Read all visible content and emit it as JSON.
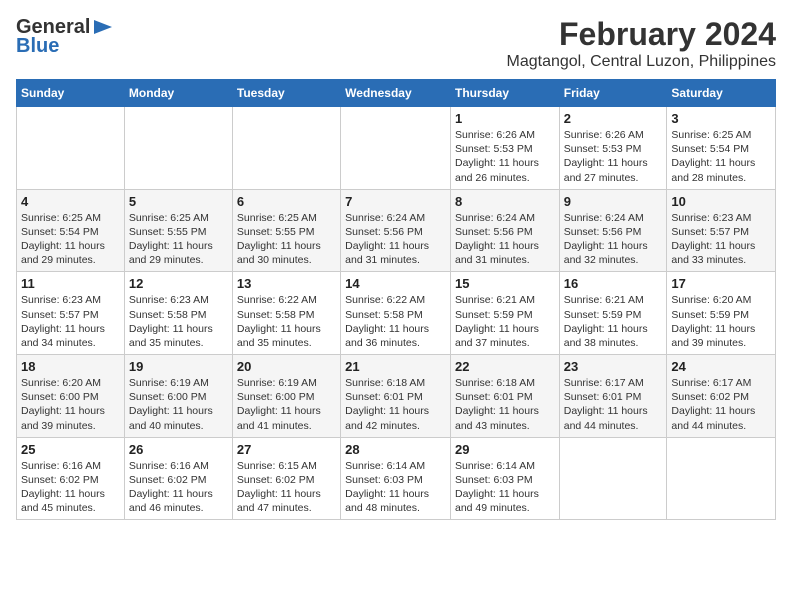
{
  "header": {
    "logo_general": "General",
    "logo_blue": "Blue",
    "month_year": "February 2024",
    "location": "Magtangol, Central Luzon, Philippines"
  },
  "weekdays": [
    "Sunday",
    "Monday",
    "Tuesday",
    "Wednesday",
    "Thursday",
    "Friday",
    "Saturday"
  ],
  "weeks": [
    [
      {
        "day": "",
        "info": ""
      },
      {
        "day": "",
        "info": ""
      },
      {
        "day": "",
        "info": ""
      },
      {
        "day": "",
        "info": ""
      },
      {
        "day": "1",
        "info": "Sunrise: 6:26 AM\nSunset: 5:53 PM\nDaylight: 11 hours and 26 minutes."
      },
      {
        "day": "2",
        "info": "Sunrise: 6:26 AM\nSunset: 5:53 PM\nDaylight: 11 hours and 27 minutes."
      },
      {
        "day": "3",
        "info": "Sunrise: 6:25 AM\nSunset: 5:54 PM\nDaylight: 11 hours and 28 minutes."
      }
    ],
    [
      {
        "day": "4",
        "info": "Sunrise: 6:25 AM\nSunset: 5:54 PM\nDaylight: 11 hours and 29 minutes."
      },
      {
        "day": "5",
        "info": "Sunrise: 6:25 AM\nSunset: 5:55 PM\nDaylight: 11 hours and 29 minutes."
      },
      {
        "day": "6",
        "info": "Sunrise: 6:25 AM\nSunset: 5:55 PM\nDaylight: 11 hours and 30 minutes."
      },
      {
        "day": "7",
        "info": "Sunrise: 6:24 AM\nSunset: 5:56 PM\nDaylight: 11 hours and 31 minutes."
      },
      {
        "day": "8",
        "info": "Sunrise: 6:24 AM\nSunset: 5:56 PM\nDaylight: 11 hours and 31 minutes."
      },
      {
        "day": "9",
        "info": "Sunrise: 6:24 AM\nSunset: 5:56 PM\nDaylight: 11 hours and 32 minutes."
      },
      {
        "day": "10",
        "info": "Sunrise: 6:23 AM\nSunset: 5:57 PM\nDaylight: 11 hours and 33 minutes."
      }
    ],
    [
      {
        "day": "11",
        "info": "Sunrise: 6:23 AM\nSunset: 5:57 PM\nDaylight: 11 hours and 34 minutes."
      },
      {
        "day": "12",
        "info": "Sunrise: 6:23 AM\nSunset: 5:58 PM\nDaylight: 11 hours and 35 minutes."
      },
      {
        "day": "13",
        "info": "Sunrise: 6:22 AM\nSunset: 5:58 PM\nDaylight: 11 hours and 35 minutes."
      },
      {
        "day": "14",
        "info": "Sunrise: 6:22 AM\nSunset: 5:58 PM\nDaylight: 11 hours and 36 minutes."
      },
      {
        "day": "15",
        "info": "Sunrise: 6:21 AM\nSunset: 5:59 PM\nDaylight: 11 hours and 37 minutes."
      },
      {
        "day": "16",
        "info": "Sunrise: 6:21 AM\nSunset: 5:59 PM\nDaylight: 11 hours and 38 minutes."
      },
      {
        "day": "17",
        "info": "Sunrise: 6:20 AM\nSunset: 5:59 PM\nDaylight: 11 hours and 39 minutes."
      }
    ],
    [
      {
        "day": "18",
        "info": "Sunrise: 6:20 AM\nSunset: 6:00 PM\nDaylight: 11 hours and 39 minutes."
      },
      {
        "day": "19",
        "info": "Sunrise: 6:19 AM\nSunset: 6:00 PM\nDaylight: 11 hours and 40 minutes."
      },
      {
        "day": "20",
        "info": "Sunrise: 6:19 AM\nSunset: 6:00 PM\nDaylight: 11 hours and 41 minutes."
      },
      {
        "day": "21",
        "info": "Sunrise: 6:18 AM\nSunset: 6:01 PM\nDaylight: 11 hours and 42 minutes."
      },
      {
        "day": "22",
        "info": "Sunrise: 6:18 AM\nSunset: 6:01 PM\nDaylight: 11 hours and 43 minutes."
      },
      {
        "day": "23",
        "info": "Sunrise: 6:17 AM\nSunset: 6:01 PM\nDaylight: 11 hours and 44 minutes."
      },
      {
        "day": "24",
        "info": "Sunrise: 6:17 AM\nSunset: 6:02 PM\nDaylight: 11 hours and 44 minutes."
      }
    ],
    [
      {
        "day": "25",
        "info": "Sunrise: 6:16 AM\nSunset: 6:02 PM\nDaylight: 11 hours and 45 minutes."
      },
      {
        "day": "26",
        "info": "Sunrise: 6:16 AM\nSunset: 6:02 PM\nDaylight: 11 hours and 46 minutes."
      },
      {
        "day": "27",
        "info": "Sunrise: 6:15 AM\nSunset: 6:02 PM\nDaylight: 11 hours and 47 minutes."
      },
      {
        "day": "28",
        "info": "Sunrise: 6:14 AM\nSunset: 6:03 PM\nDaylight: 11 hours and 48 minutes."
      },
      {
        "day": "29",
        "info": "Sunrise: 6:14 AM\nSunset: 6:03 PM\nDaylight: 11 hours and 49 minutes."
      },
      {
        "day": "",
        "info": ""
      },
      {
        "day": "",
        "info": ""
      }
    ]
  ]
}
